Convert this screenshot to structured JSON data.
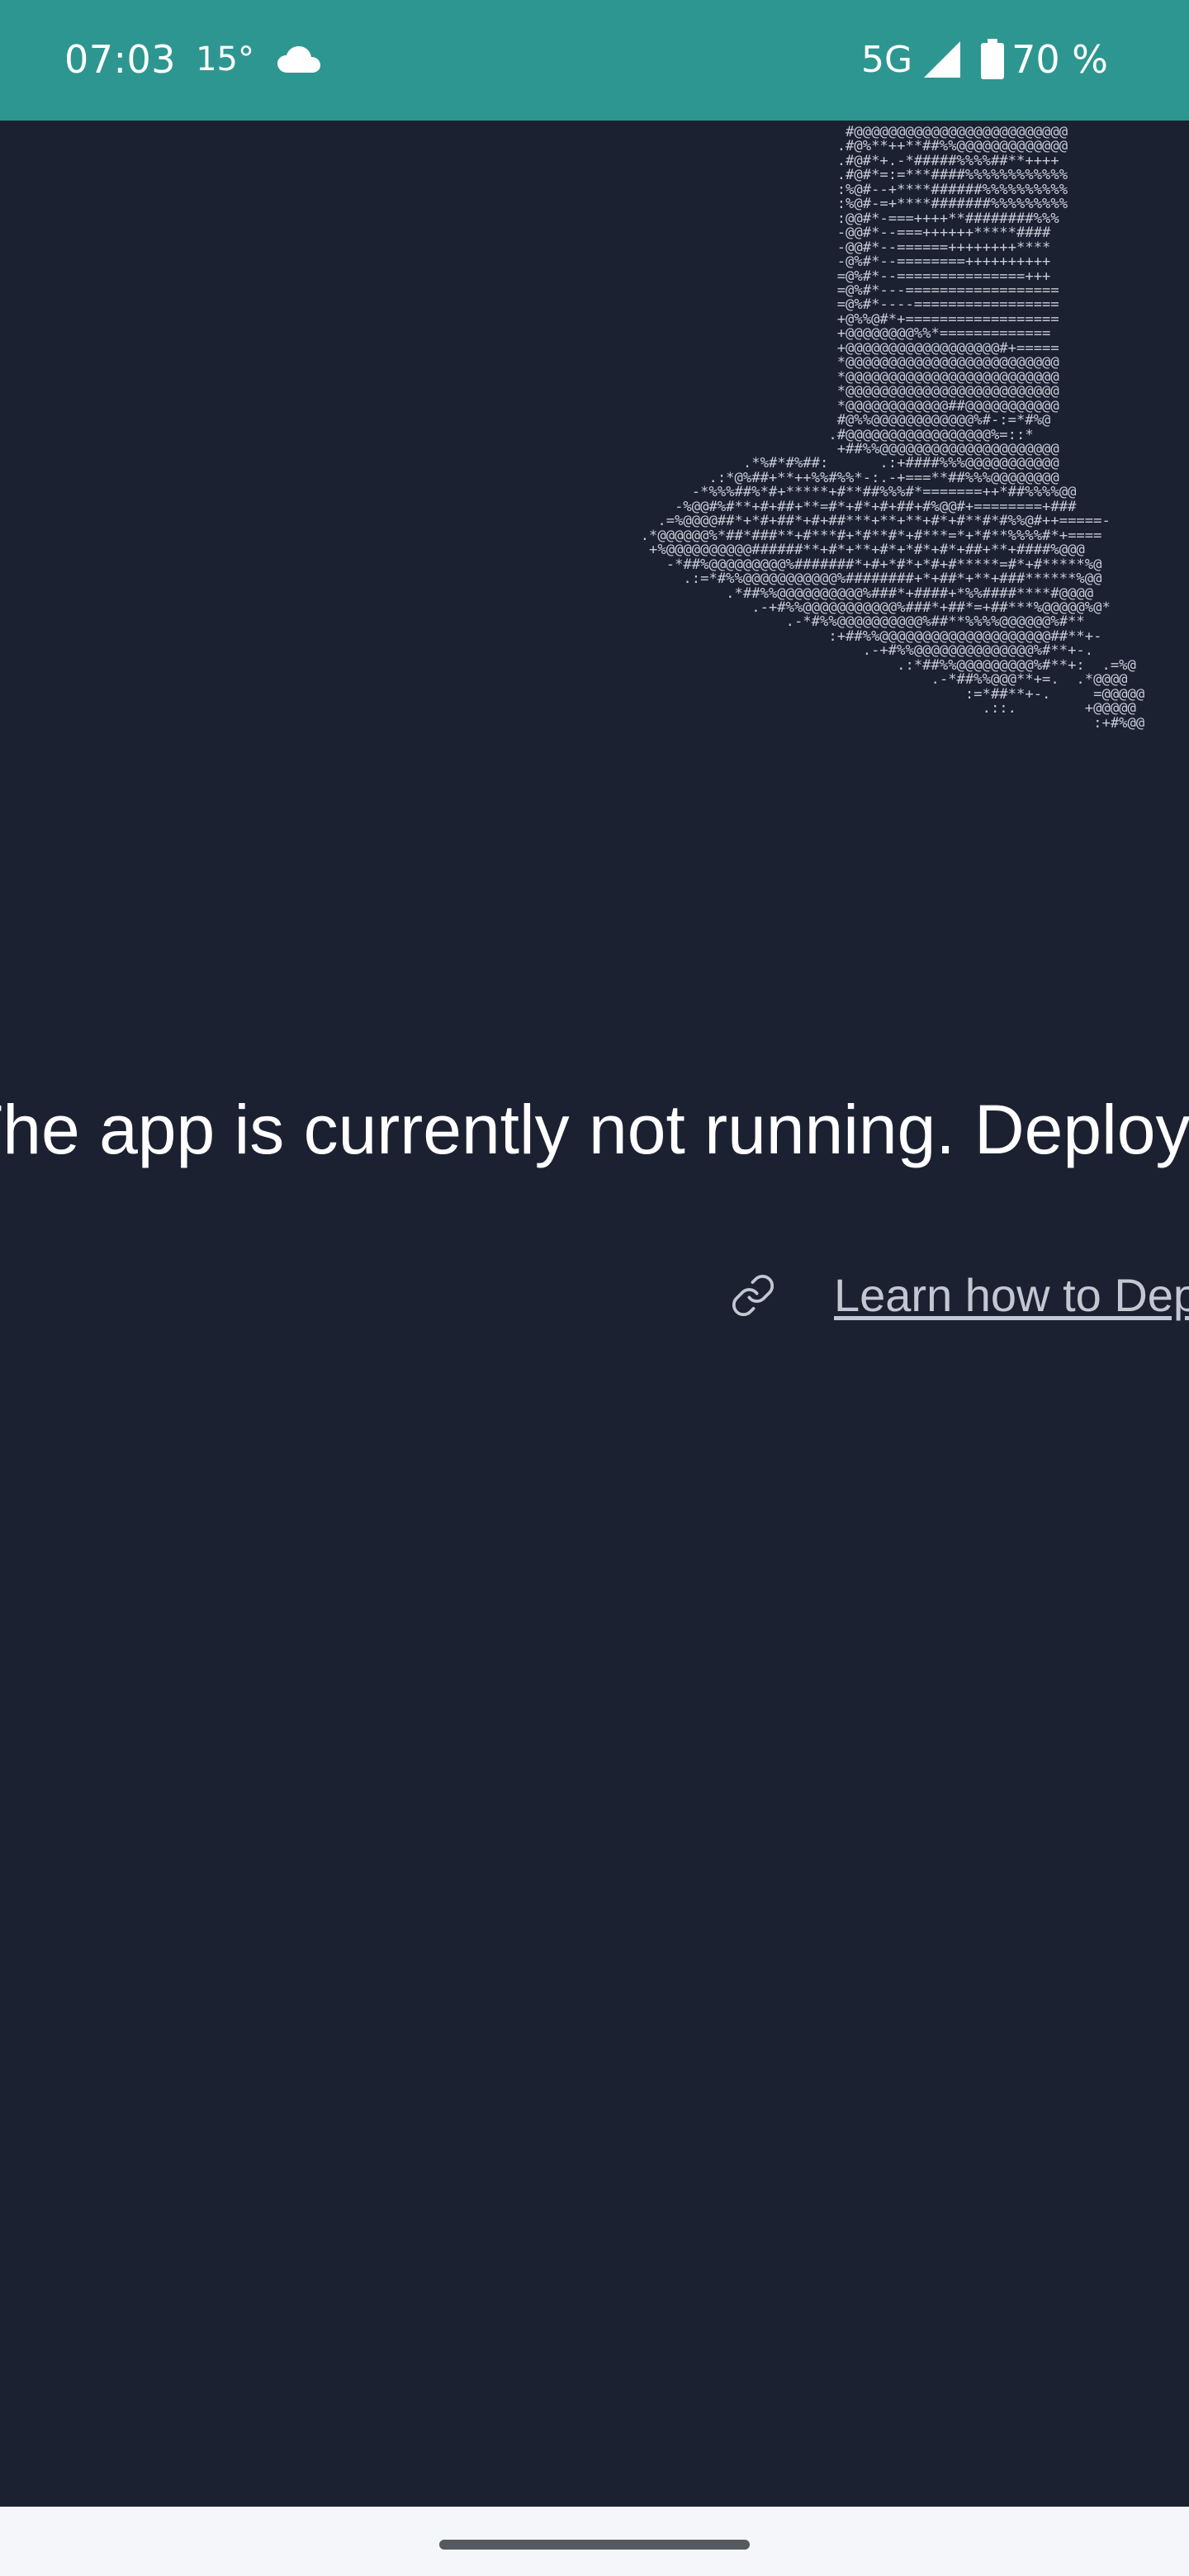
{
  "status_bar": {
    "time": "07:03",
    "temperature": "15°",
    "weather_icon": "cloud-icon",
    "network": "5G",
    "signal_icon": "signal-icon",
    "battery_icon": "battery-icon",
    "battery_percent": "70 %"
  },
  "ascii_art": "                          #@@@@@@@@@@@@@@@@@@@@@@@@@\n                         .#@%**++**##%%@@@@@@@@@@@@@\n                         .#@#*+.-*#####%%%%##**++++\n                         .#@#*=:=***####%%%%%%%%%%%%\n                         :%@#--+****######%%%%%%%%%%\n                         :%@#-=+****#######%%%%%%%%%\n                         :@@#*-===++++**########%%%\n                         -@@#*--===++++++*****####\n                         -@@#*--======++++++++****\n                         -@%#*--========++++++++++\n                         =@%#*--===============+++\n                         =@%#*---==================\n                         =@%#*----=================\n                         +@%%@#*+==================\n                         +@@@@@@@@%%*=============\n                         +@@@@@@@@@@@@@@@@@@#+=====\n                         *@@@@@@@@@@@@@@@@@@@@@@@@@\n                         *@@@@@@@@@@@@@@@@@@@@@@@@@\n                         *@@@@@@@@@@@@@@@@@@@@@@@@@\n                         *@@@@@@@@@@@@##@@@@@@@@@@@\n                         #@%%@@@@@@@@@@@@%#-:=*#%@\n                        .#@@@@@@@@@@@@@@@@@%=::*\n                         +##%%@@@@@@@@@@@@@@@@@@@@@\n              .*%#*#%##:      .:+####%%%@@@@@@@@@@@\n          .:*@%##+**++%%#%%*-:.-+===**##%%%@@@@@@@@\n        -*%%%##%*#+*****+#**##%%%#*=======++*##%%%%@@\n      -%@@#%#**+#+##+**=#*+#*+#+##+#%@@#+========+###\n    .=%@@@@##*+*#+##*+#+##***+**+**+#*+#**#*#%%@#++=====-\n  .*@@@@@@%*##*###**+#***#+*#**#*+#***=*+*#**%%%%#*+====\n   +%@@@@@@@@@@######**+#*+**+#*+*#*+#*+##+**+####%@@@\n     -*##%@@@@@@@@@%#######*+#+*#*+*#+#*****=#*+#*****%@\n       .:=*#%%@@@@@@@@@@@%########+*+##*+**+###******%@@\n            .*##%%@@@@@@@@@@%###*+####+*%%####****#@@@@\n               .-+#%%@@@@@@@@@@@%###*+##*=+##***%@@@@@%@*\n                   .-*#%%@@@@@@@@@@%##**%%%%@@@@@@%#**\n                        :+##%%@@@@@@@@@@@@@@@@@@@@##**+-\n                            .-+#%%@@@@@@@@@@@@@@%#**+-.\n                                .:*##%%@@@@@@@@@%#**+:  .=%@\n                                    .-*##%%@@@**+=.  .*@@@@\n                                        :=*##**+-.     =@@@@@\n                                          .::.        +@@@@@\n                                                       :+#%@@",
  "main": {
    "message": "The app is currently not running. Deploy the app to start it.",
    "link_icon": "link-icon",
    "link_text": "Learn how to Deploy"
  },
  "nav_bar": {
    "handle": "gesture-handle"
  }
}
